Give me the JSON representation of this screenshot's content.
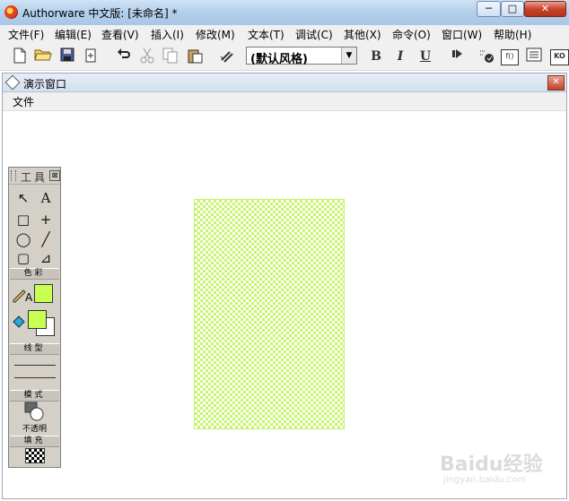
{
  "window": {
    "title": "Authorware 中文版: [未命名] *",
    "minimize": "─",
    "maximize": "□",
    "close": "✕"
  },
  "menubar": [
    "文件(F)",
    "编辑(E)",
    "查看(V)",
    "插入(I)",
    "修改(M)",
    "文本(T)",
    "调试(C)",
    "其他(X)",
    "命令(O)",
    "窗口(W)",
    "帮助(H)"
  ],
  "toolbar": {
    "style_select": "(默认风格)",
    "buttons": [
      "new-icon",
      "open-icon",
      "save-all-icon",
      "import-icon",
      "undo-icon",
      "cut-icon",
      "copy-icon",
      "paste-icon",
      "find-icon",
      "bold-icon",
      "italic-icon",
      "underline-icon",
      "restart-icon",
      "control-panel-icon",
      "functions-icon",
      "variables-icon",
      "knowledge-objects-icon"
    ],
    "bold": "B",
    "italic": "I",
    "underline": "U",
    "fx": "f()",
    "ko": "KO"
  },
  "presentation": {
    "title": "演示窗口",
    "close": "✕",
    "menu_file": "文件"
  },
  "palette": {
    "title": "工具",
    "close": "⊠",
    "tools": {
      "pointer": "↖",
      "text": "A",
      "rectangle": "□",
      "line_straight": "+",
      "oval": "◯",
      "line_diagonal": "╱",
      "rounded_rect": "▢",
      "polygon": "⊿"
    },
    "section_color": "色彩",
    "section_line": "线型",
    "section_mode": "模式",
    "section_fill": "填充",
    "text_color_letter": "A",
    "mode_label": "不透明",
    "colors": {
      "text_color": "#c8ff50",
      "fill_foreground": "#c8ff50",
      "fill_background": "#ffffff"
    }
  },
  "canvas_rect": {
    "fill_color": "#c8f56e"
  },
  "watermark": {
    "text": "Baidu经验",
    "url": "jingyan.baidu.com"
  }
}
